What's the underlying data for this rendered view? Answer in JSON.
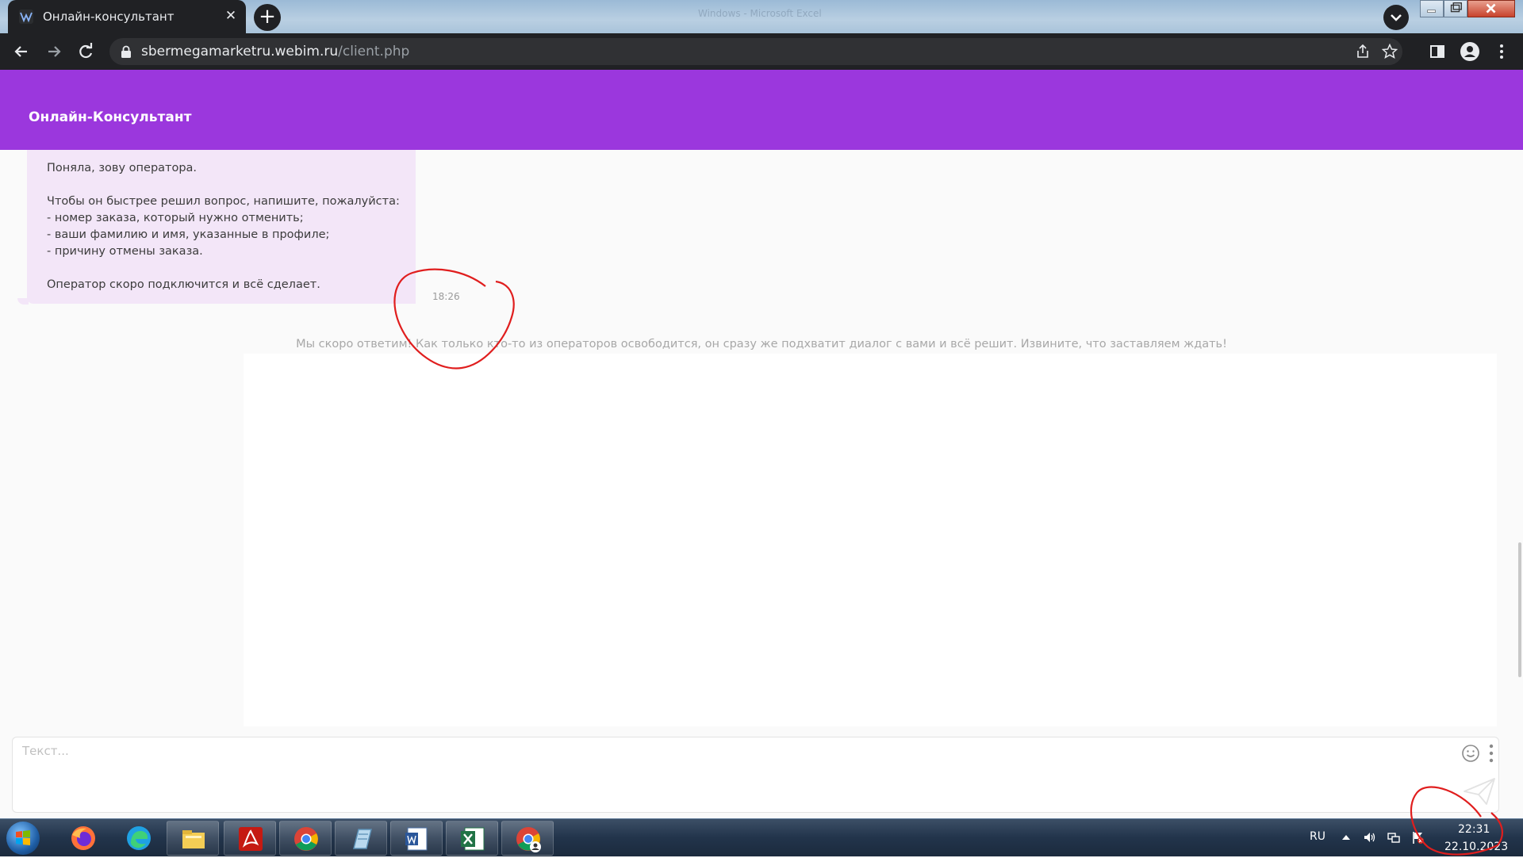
{
  "browser": {
    "tab_title": "Онлайн-консультант",
    "url_host": "sbermegamarketru.webim.ru",
    "url_path": "/client.php",
    "window_title_ghost": "Windows - Microsoft Excel"
  },
  "header": {
    "title": "Онлайн-Консультант"
  },
  "chat": {
    "operator_message": {
      "lines": [
        "Поняла, зову оператора.",
        "Чтобы он быстрее решил вопрос, напишите, пожалуйста:",
        "- номер заказа, который нужно отменить;",
        "- ваши фамилию и имя, указанные в профиле;",
        "- причину отмены заказа.",
        "Оператор скоро подключится и всё сделает."
      ],
      "time": "18:26"
    },
    "system_message": "Мы скоро ответим! Как только кто-то из операторов освободится, он сразу же подхватит диалог с вами и всё решит. Извините, что заставляем ждать!"
  },
  "composer": {
    "placeholder": "Текст..."
  },
  "taskbar": {
    "apps": [
      "firefox-icon",
      "edge-icon",
      "file-explorer-icon",
      "acrobat-icon",
      "chrome-icon",
      "notepad-icon",
      "word-icon",
      "excel-icon",
      "chrome-profile-icon"
    ],
    "language": "RU",
    "time": "22:31",
    "date": "22.10.2023"
  },
  "colors": {
    "accent": "#9b37dd",
    "bubble": "#f3e6f8",
    "annotation": "#e01e1e"
  }
}
